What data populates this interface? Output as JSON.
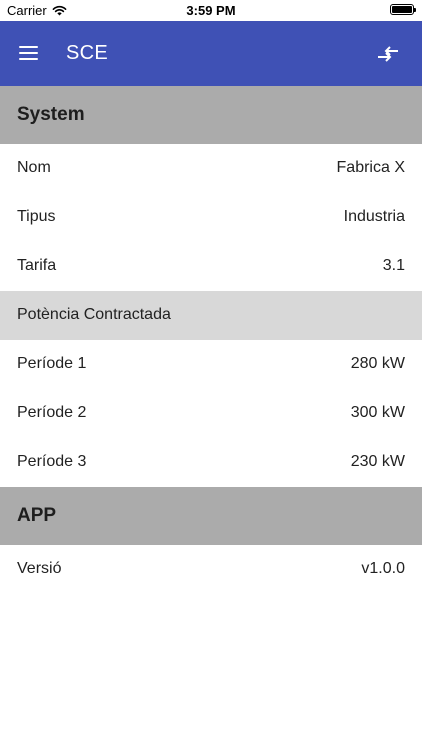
{
  "status_bar": {
    "carrier": "Carrier",
    "time": "3:59 PM",
    "icons": [
      "wifi-icon",
      "battery-icon"
    ]
  },
  "app_bar": {
    "title": "SCE",
    "background": "#3f51b5",
    "left_icon": "menu-icon",
    "right_icon": "compare-arrows-icon"
  },
  "sections": {
    "system": {
      "title": "System",
      "rows": {
        "nom": {
          "label": "Nom",
          "value": "Fabrica X"
        },
        "tipus": {
          "label": "Tipus",
          "value": "Industria"
        },
        "tarifa": {
          "label": "Tarifa",
          "value": "3.1"
        }
      },
      "subsection": {
        "title": "Potència Contractada",
        "rows": {
          "p1": {
            "label": "Període 1",
            "value": "280 kW"
          },
          "p2": {
            "label": "Període 2",
            "value": "300 kW"
          },
          "p3": {
            "label": "Període 3",
            "value": "230 kW"
          }
        }
      }
    },
    "app": {
      "title": "APP",
      "rows": {
        "versio": {
          "label": "Versió",
          "value": "v1.0.0"
        }
      }
    }
  }
}
